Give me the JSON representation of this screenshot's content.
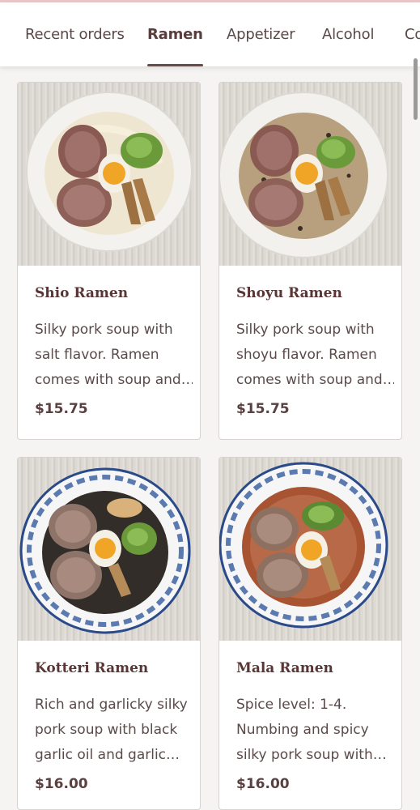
{
  "tabs": [
    {
      "label": "Recent orders",
      "active": false
    },
    {
      "label": "Ramen",
      "active": true
    },
    {
      "label": "Appetizer",
      "active": false
    },
    {
      "label": "Alcohol",
      "active": false
    },
    {
      "label": "Co",
      "active": false
    }
  ],
  "items": [
    {
      "name": "Shio Ramen",
      "desc_lines": [
        "Silky pork soup with",
        "salt flavor. Ramen",
        "comes with soup and…"
      ],
      "price": "$15.75",
      "broth_color": "#f1e9d6",
      "bowl_style": "white"
    },
    {
      "name": "Shoyu Ramen",
      "desc_lines": [
        "Silky pork soup with",
        "shoyu flavor. Ramen",
        "comes with soup and…"
      ],
      "price": "$15.75",
      "broth_color": "#b79a78",
      "bowl_style": "white"
    },
    {
      "name": "Kotteri Ramen",
      "desc_lines": [
        "Rich and garlicky silky",
        "pork soup with black",
        "garlic oil and garlic…"
      ],
      "price": "$16.00",
      "broth_color": "#2f2a28",
      "bowl_style": "blue-pattern"
    },
    {
      "name": "Mala Ramen",
      "desc_lines": [
        "Spice level: 1-4.",
        "Numbing and spicy",
        "silky pork soup with…"
      ],
      "price": "$16.00",
      "broth_color": "#a85432",
      "bowl_style": "blue-pattern"
    }
  ],
  "colors": {
    "accent": "#6b4a4a",
    "title": "#5a3535",
    "background": "#f6f4f2"
  }
}
